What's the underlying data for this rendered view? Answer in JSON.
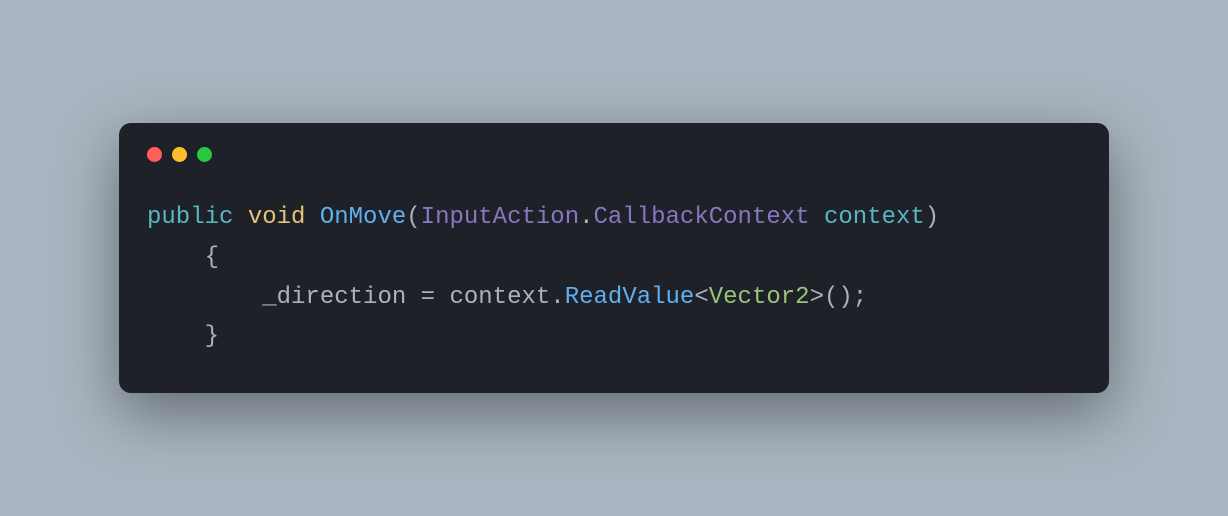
{
  "code": {
    "line1": {
      "kw_public": "public",
      "kw_void": "void",
      "method": "OnMove",
      "paren_open": "(",
      "type1": "InputAction",
      "dot": ".",
      "type2": "CallbackContext",
      "param": "context",
      "paren_close": ")"
    },
    "line2": {
      "brace_open": "{"
    },
    "line3": {
      "ident": "_direction",
      "eq": "=",
      "obj": "context",
      "dot": ".",
      "call": "ReadValue",
      "lt": "<",
      "generic": "Vector2",
      "gt": ">",
      "parens": "()",
      "semi": ";"
    },
    "line4": {
      "brace_close": "}"
    }
  },
  "buttons": {
    "close": "close",
    "minimize": "minimize",
    "zoom": "zoom"
  }
}
